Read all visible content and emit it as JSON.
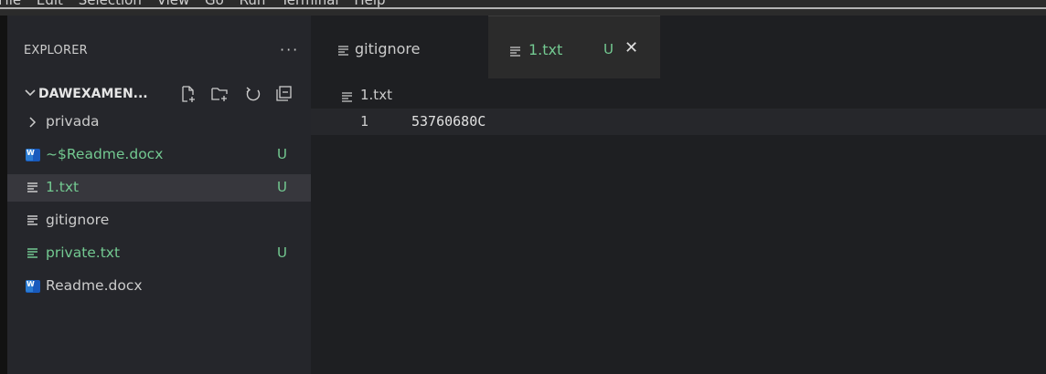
{
  "menu": [
    "File",
    "Edit",
    "Selection",
    "View",
    "Go",
    "Run",
    "Terminal",
    "Help"
  ],
  "sidebar": {
    "title": "EXPLORER",
    "more": "···",
    "project": "DAWEXAMEN...",
    "actions": [
      "new-file-icon",
      "new-folder-icon",
      "refresh-icon",
      "collapse-all-icon"
    ],
    "items": [
      {
        "label": "privada",
        "kind": "folder",
        "badge": "",
        "color": "normal"
      },
      {
        "label": "~$Readme.docx",
        "kind": "word",
        "badge": "U",
        "color": "green"
      },
      {
        "label": "1.txt",
        "kind": "text",
        "badge": "U",
        "color": "green"
      },
      {
        "label": "gitignore",
        "kind": "text",
        "badge": "",
        "color": "normal"
      },
      {
        "label": "private.txt",
        "kind": "text",
        "badge": "U",
        "color": "green"
      },
      {
        "label": "Readme.docx",
        "kind": "word",
        "badge": "",
        "color": "normal"
      }
    ]
  },
  "tabs": [
    {
      "label": "gitignore",
      "modified": "",
      "active": false
    },
    {
      "label": "1.txt",
      "modified": "U",
      "active": true
    }
  ],
  "editor": {
    "breadcrumb": "1.txt",
    "lines": [
      {
        "number": "1",
        "text": "53760680C"
      }
    ]
  },
  "colors": {
    "untracked": "#73c991",
    "selection": "#37373d",
    "background": "#1e1f22"
  }
}
